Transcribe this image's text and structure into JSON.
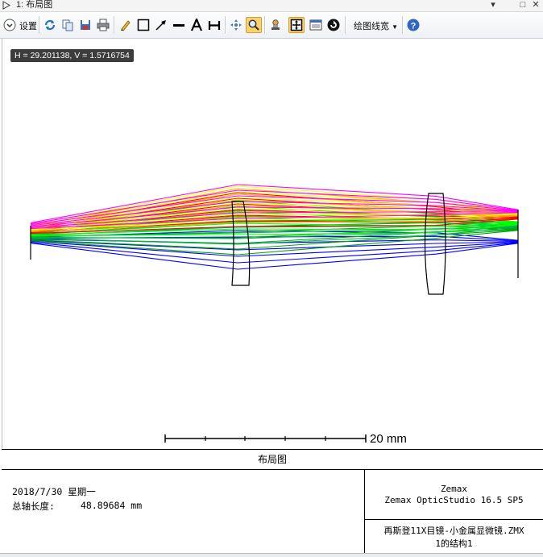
{
  "window": {
    "title": "1: 布局图",
    "controls": [
      "▾",
      "□",
      "✕"
    ]
  },
  "toolbar": {
    "settings_label": "设置",
    "linewidth_label": "绘图线宽",
    "icons": [
      "settings-chevron-icon",
      "refresh-icon",
      "copy-icon",
      "save-icon",
      "print-icon",
      "pencil-icon",
      "rectangle-icon",
      "arrow-icon",
      "line-icon",
      "text-icon",
      "dimension-icon",
      "pan-icon",
      "zoom-icon",
      "stamp-icon",
      "grid-toggle-icon",
      "window-icon",
      "rotate-icon",
      "help-icon"
    ],
    "active_tool": "zoom-icon"
  },
  "coordinate_readout": "H = 29.201138, V = 1.5716754",
  "plot": {
    "scale_bar_label": "20 mm",
    "ray_colors": [
      "#0000ff",
      "#00b050",
      "#00ff00",
      "#ff0000",
      "#ffa500",
      "#ffff00",
      "#ff00ff",
      "#00aa00"
    ]
  },
  "footer": {
    "title": "布局图",
    "date": "2018/7/30 星期一",
    "length_label": "总轴长度:",
    "length_value": "48.89684 mm",
    "company": "Zemax",
    "software": "Zemax OpticStudio 16.5 SP5",
    "file": "再斯登11X目镜-小金属显微镜.ZMX",
    "config": "1的结构1"
  }
}
